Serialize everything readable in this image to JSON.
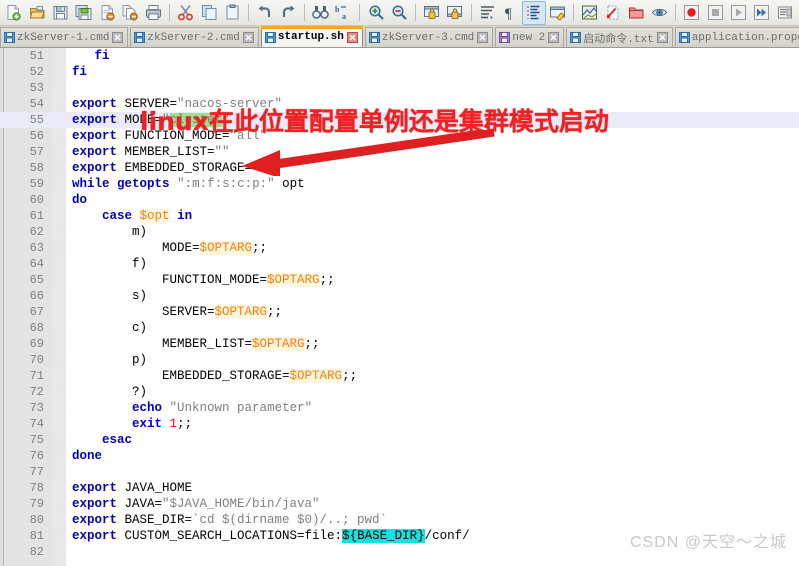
{
  "toolbar": {
    "groups": [
      {
        "items": [
          {
            "name": "new-file-icon",
            "label": "New"
          },
          {
            "name": "open-file-icon",
            "label": "Open"
          },
          {
            "name": "save-icon",
            "label": "Save"
          },
          {
            "name": "save-all-icon",
            "label": "Save All"
          },
          {
            "name": "close-file-icon",
            "label": "Close"
          },
          {
            "name": "close-all-icon",
            "label": "Close All"
          },
          {
            "name": "print-icon",
            "label": "Print"
          }
        ]
      },
      {
        "items": [
          {
            "name": "cut-icon",
            "label": "Cut"
          },
          {
            "name": "copy-icon",
            "label": "Copy"
          },
          {
            "name": "paste-icon",
            "label": "Paste"
          }
        ]
      },
      {
        "items": [
          {
            "name": "undo-icon",
            "label": "Undo"
          },
          {
            "name": "redo-icon",
            "label": "Redo"
          }
        ]
      },
      {
        "items": [
          {
            "name": "find-icon",
            "label": "Find"
          },
          {
            "name": "replace-icon",
            "label": "Replace"
          }
        ]
      },
      {
        "items": [
          {
            "name": "zoom-in-icon",
            "label": "Zoom In"
          },
          {
            "name": "zoom-out-icon",
            "label": "Zoom Out"
          }
        ]
      },
      {
        "items": [
          {
            "name": "sync-vertical-scroll-icon",
            "label": "Synchronize Vertical Scrolling"
          },
          {
            "name": "sync-horizontal-scroll-icon",
            "label": "Synchronize Horizontal Scrolling"
          }
        ]
      },
      {
        "items": [
          {
            "name": "word-wrap-icon",
            "label": "Word wrap"
          },
          {
            "name": "show-all-characters-icon",
            "label": "Show All Characters"
          },
          {
            "name": "show-indent-guide-icon",
            "label": "Show Indent Guide",
            "active": true
          },
          {
            "name": "user-defined-dialog-icon",
            "label": "User Defined Dialogue"
          }
        ]
      },
      {
        "items": [
          {
            "name": "document-map-icon",
            "label": "Document Map"
          },
          {
            "name": "function-list-icon",
            "label": "Function List"
          },
          {
            "name": "folder-as-workspace-icon",
            "label": "Folder as Workspace"
          },
          {
            "name": "monitoring-icon",
            "label": "Monitoring"
          }
        ]
      },
      {
        "items": [
          {
            "name": "macro-record-icon",
            "label": "Start Recording"
          },
          {
            "name": "macro-stop-icon",
            "label": "Stop Recording"
          },
          {
            "name": "macro-play-icon",
            "label": "Playback"
          },
          {
            "name": "macro-run-multiple-icon",
            "label": "Run a Macro Multiple Times"
          },
          {
            "name": "macro-save-icon",
            "label": "Save Current Recorded Macro"
          }
        ]
      }
    ]
  },
  "tabs": [
    {
      "label": "zkServer-1.cmd",
      "active": false,
      "disk": "blue"
    },
    {
      "label": "zkServer-2.cmd",
      "active": false,
      "disk": "blue"
    },
    {
      "label": "startup.sh",
      "active": true,
      "disk": "blue"
    },
    {
      "label": "zkServer-3.cmd",
      "active": false,
      "disk": "blue"
    },
    {
      "label": "new 2",
      "active": false,
      "disk": "purple"
    },
    {
      "label": "启动命令.txt",
      "active": false,
      "disk": "blue"
    },
    {
      "label": "application.properti",
      "active": false,
      "disk": "blue"
    }
  ],
  "annotation": {
    "text": "linux在此位置配置单例还是集群模式启动",
    "color": "#ee2222",
    "arrow_color": "#e02020"
  },
  "watermark": {
    "text": "CSDN @天空～之城"
  },
  "editor": {
    "current_line": 55,
    "selection_highlight": "cluster",
    "selection_color": "#93e693",
    "smart_highlight_color": "#16e0e0",
    "first_line": 51,
    "last_line": 82,
    "lines": [
      {
        "n": 51,
        "tokens": [
          {
            "t": "   ",
            "c": "plain"
          },
          {
            "t": "fi",
            "c": "kw"
          }
        ]
      },
      {
        "n": 52,
        "tokens": [
          {
            "t": "fi",
            "c": "kw"
          }
        ]
      },
      {
        "n": 53,
        "tokens": []
      },
      {
        "n": 54,
        "tokens": [
          {
            "t": "export",
            "c": "kw"
          },
          {
            "t": " SERVER=",
            "c": "plain"
          },
          {
            "t": "\"nacos-server\"",
            "c": "str"
          }
        ]
      },
      {
        "n": 55,
        "cur": true,
        "tokens": [
          {
            "t": "export",
            "c": "kw"
          },
          {
            "t": " MODE=",
            "c": "plain"
          },
          {
            "t": "\"",
            "c": "str"
          },
          {
            "t": "cluster",
            "c": "hl-green"
          },
          {
            "t": "\"",
            "c": "str"
          }
        ]
      },
      {
        "n": 56,
        "tokens": [
          {
            "t": "export",
            "c": "kw"
          },
          {
            "t": " FUNCTION_MODE=",
            "c": "plain"
          },
          {
            "t": "\"all\"",
            "c": "str"
          }
        ]
      },
      {
        "n": 57,
        "tokens": [
          {
            "t": "export",
            "c": "kw"
          },
          {
            "t": " MEMBER_LIST=",
            "c": "plain"
          },
          {
            "t": "\"\"",
            "c": "str"
          }
        ]
      },
      {
        "n": 58,
        "tokens": [
          {
            "t": "export",
            "c": "kw"
          },
          {
            "t": " EMBEDDED_STORAGE=",
            "c": "plain"
          },
          {
            "t": "\"\"",
            "c": "str"
          }
        ]
      },
      {
        "n": 59,
        "tokens": [
          {
            "t": "while",
            "c": "kw"
          },
          {
            "t": " ",
            "c": "plain"
          },
          {
            "t": "getopts",
            "c": "kw"
          },
          {
            "t": " ",
            "c": "plain"
          },
          {
            "t": "\":m:f:s:c:p:\"",
            "c": "str"
          },
          {
            "t": " opt",
            "c": "plain"
          }
        ]
      },
      {
        "n": 60,
        "tokens": [
          {
            "t": "do",
            "c": "kw"
          }
        ]
      },
      {
        "n": 61,
        "tokens": [
          {
            "t": "    ",
            "c": "plain"
          },
          {
            "t": "case",
            "c": "kw"
          },
          {
            "t": " ",
            "c": "plain"
          },
          {
            "t": "$opt",
            "c": "var"
          },
          {
            "t": " ",
            "c": "plain"
          },
          {
            "t": "in",
            "c": "kw"
          }
        ]
      },
      {
        "n": 62,
        "tokens": [
          {
            "t": "        m)",
            "c": "plain"
          }
        ]
      },
      {
        "n": 63,
        "tokens": [
          {
            "t": "            MODE=",
            "c": "plain"
          },
          {
            "t": "$OPTARG",
            "c": "var"
          },
          {
            "t": ";;",
            "c": "plain"
          }
        ]
      },
      {
        "n": 64,
        "tokens": [
          {
            "t": "        f)",
            "c": "plain"
          }
        ]
      },
      {
        "n": 65,
        "tokens": [
          {
            "t": "            FUNCTION_MODE=",
            "c": "plain"
          },
          {
            "t": "$OPTARG",
            "c": "var"
          },
          {
            "t": ";;",
            "c": "plain"
          }
        ]
      },
      {
        "n": 66,
        "tokens": [
          {
            "t": "        s)",
            "c": "plain"
          }
        ]
      },
      {
        "n": 67,
        "tokens": [
          {
            "t": "            SERVER=",
            "c": "plain"
          },
          {
            "t": "$OPTARG",
            "c": "var"
          },
          {
            "t": ";;",
            "c": "plain"
          }
        ]
      },
      {
        "n": 68,
        "tokens": [
          {
            "t": "        c)",
            "c": "plain"
          }
        ]
      },
      {
        "n": 69,
        "tokens": [
          {
            "t": "            MEMBER_LIST=",
            "c": "plain"
          },
          {
            "t": "$OPTARG",
            "c": "var"
          },
          {
            "t": ";;",
            "c": "plain"
          }
        ]
      },
      {
        "n": 70,
        "tokens": [
          {
            "t": "        p)",
            "c": "plain"
          }
        ]
      },
      {
        "n": 71,
        "tokens": [
          {
            "t": "            EMBEDDED_STORAGE=",
            "c": "plain"
          },
          {
            "t": "$OPTARG",
            "c": "var"
          },
          {
            "t": ";;",
            "c": "plain"
          }
        ]
      },
      {
        "n": 72,
        "tokens": [
          {
            "t": "        ?)",
            "c": "plain"
          }
        ]
      },
      {
        "n": 73,
        "tokens": [
          {
            "t": "        ",
            "c": "plain"
          },
          {
            "t": "echo",
            "c": "kw"
          },
          {
            "t": " ",
            "c": "plain"
          },
          {
            "t": "\"Unknown parameter\"",
            "c": "str"
          }
        ]
      },
      {
        "n": 74,
        "tokens": [
          {
            "t": "        ",
            "c": "plain"
          },
          {
            "t": "exit",
            "c": "kw"
          },
          {
            "t": " ",
            "c": "plain"
          },
          {
            "t": "1",
            "c": "num"
          },
          {
            "t": ";;",
            "c": "plain"
          }
        ]
      },
      {
        "n": 75,
        "tokens": [
          {
            "t": "    ",
            "c": "plain"
          },
          {
            "t": "esac",
            "c": "kw"
          }
        ]
      },
      {
        "n": 76,
        "tokens": [
          {
            "t": "done",
            "c": "kw"
          }
        ]
      },
      {
        "n": 77,
        "tokens": []
      },
      {
        "n": 78,
        "tokens": [
          {
            "t": "export",
            "c": "kw"
          },
          {
            "t": " JAVA_HOME",
            "c": "plain"
          }
        ]
      },
      {
        "n": 79,
        "tokens": [
          {
            "t": "export",
            "c": "kw"
          },
          {
            "t": " JAVA=",
            "c": "plain"
          },
          {
            "t": "\"$JAVA_HOME/bin/java\"",
            "c": "str"
          }
        ]
      },
      {
        "n": 80,
        "tokens": [
          {
            "t": "export",
            "c": "kw"
          },
          {
            "t": " BASE_DIR=",
            "c": "plain"
          },
          {
            "t": "`cd $(dirname $0)/..; pwd`",
            "c": "str"
          }
        ]
      },
      {
        "n": 81,
        "tokens": [
          {
            "t": "export",
            "c": "kw"
          },
          {
            "t": " CUSTOM_SEARCH_LOCATIONS=file:",
            "c": "plain"
          },
          {
            "t": "${BASE_DIR}",
            "c": "hl-cyan"
          },
          {
            "t": "/conf/",
            "c": "plain"
          }
        ]
      },
      {
        "n": 82,
        "tokens": []
      }
    ]
  }
}
